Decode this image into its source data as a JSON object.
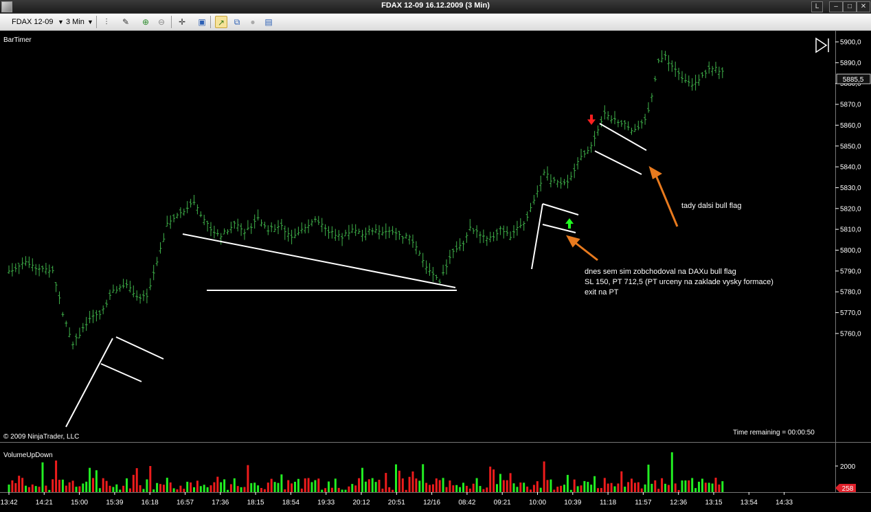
{
  "window": {
    "title": "FDAX 12-09  16.12.2009 (3 Min)",
    "buttons": [
      "L",
      "–",
      "□",
      "✕"
    ]
  },
  "toolbar": {
    "instrument": "FDAX 12-09",
    "interval": "3 Min",
    "icons": [
      "bar-type-icon",
      "draw-pen-icon",
      "zoom-in-icon",
      "zoom-out-icon",
      "crosshair-icon",
      "properties-icon",
      "indicators-icon",
      "strategies-icon",
      "data-box-icon",
      "chart-list-icon"
    ]
  },
  "chart": {
    "indicator_top": "BarTimer",
    "copyright": "© 2009 NinjaTrader, LLC",
    "time_remaining": "Time remaining = 00:00:50",
    "indicator_bottom": "VolumeUpDown",
    "last_price": "5885,5",
    "volume_badge": "258",
    "volume_axis_label": "2000",
    "play_icon": "skip-forward-icon"
  },
  "chart_data": {
    "type": "bar",
    "instrument": "FDAX 12-09",
    "interval": "3 Min",
    "y_ticks": [
      "5900,0",
      "5890,0",
      "5880,0",
      "5870,0",
      "5860,0",
      "5850,0",
      "5840,0",
      "5830,0",
      "5820,0",
      "5810,0",
      "5800,0",
      "5790,0",
      "5780,0",
      "5770,0",
      "5760,0"
    ],
    "ylim": [
      5750,
      5905
    ],
    "x_ticks": [
      "13:42",
      "14:21",
      "15:00",
      "15:39",
      "16:18",
      "16:57",
      "17:36",
      "18:15",
      "18:54",
      "19:33",
      "20:12",
      "20:51",
      "12/16",
      "08:42",
      "09:21",
      "10:00",
      "10:39",
      "11:18",
      "11:57",
      "12:36",
      "13:15",
      "13:54",
      "14:33"
    ],
    "price_path": [
      [
        0,
        5790
      ],
      [
        5,
        5795
      ],
      [
        9,
        5791
      ],
      [
        13,
        5790
      ],
      [
        16,
        5770
      ],
      [
        19,
        5755
      ],
      [
        23,
        5765
      ],
      [
        27,
        5770
      ],
      [
        31,
        5780
      ],
      [
        35,
        5783
      ],
      [
        38,
        5777
      ],
      [
        41,
        5778
      ],
      [
        44,
        5795
      ],
      [
        47,
        5812
      ],
      [
        51,
        5818
      ],
      [
        55,
        5823
      ],
      [
        57,
        5817
      ],
      [
        60,
        5810
      ],
      [
        63,
        5807
      ],
      [
        67,
        5813
      ],
      [
        70,
        5808
      ],
      [
        74,
        5815
      ],
      [
        77,
        5810
      ],
      [
        81,
        5811
      ],
      [
        84,
        5807
      ],
      [
        88,
        5811
      ],
      [
        91,
        5814
      ],
      [
        95,
        5809
      ],
      [
        99,
        5806
      ],
      [
        102,
        5810
      ],
      [
        105,
        5808
      ],
      [
        109,
        5810
      ],
      [
        112,
        5809
      ],
      [
        116,
        5807
      ],
      [
        119,
        5806
      ],
      [
        122,
        5798
      ],
      [
        125,
        5790
      ],
      [
        128,
        5785
      ],
      [
        131,
        5797
      ],
      [
        133,
        5801
      ],
      [
        135,
        5804
      ],
      [
        137,
        5811
      ],
      [
        140,
        5807
      ],
      [
        143,
        5806
      ],
      [
        146,
        5810
      ],
      [
        149,
        5807
      ],
      [
        153,
        5813
      ],
      [
        156,
        5823
      ],
      [
        159,
        5838
      ],
      [
        161,
        5834
      ],
      [
        164,
        5831
      ],
      [
        167,
        5835
      ],
      [
        170,
        5845
      ],
      [
        173,
        5850
      ],
      [
        175,
        5858
      ],
      [
        177,
        5866
      ],
      [
        180,
        5862
      ],
      [
        183,
        5860
      ],
      [
        186,
        5857
      ],
      [
        189,
        5862
      ],
      [
        191,
        5874
      ],
      [
        193,
        5890
      ],
      [
        195,
        5893
      ],
      [
        197,
        5888
      ],
      [
        200,
        5883
      ],
      [
        203,
        5880
      ],
      [
        206,
        5884
      ],
      [
        209,
        5888
      ],
      [
        212,
        5885
      ]
    ],
    "annotations": [
      "dnes sem sim zobchodoval na DAXu bull flag",
      "SL 150, PT 712,5 (PT urceny na zaklade vysky formace)",
      "exit na PT",
      "tady dalsi bull flag"
    ]
  }
}
